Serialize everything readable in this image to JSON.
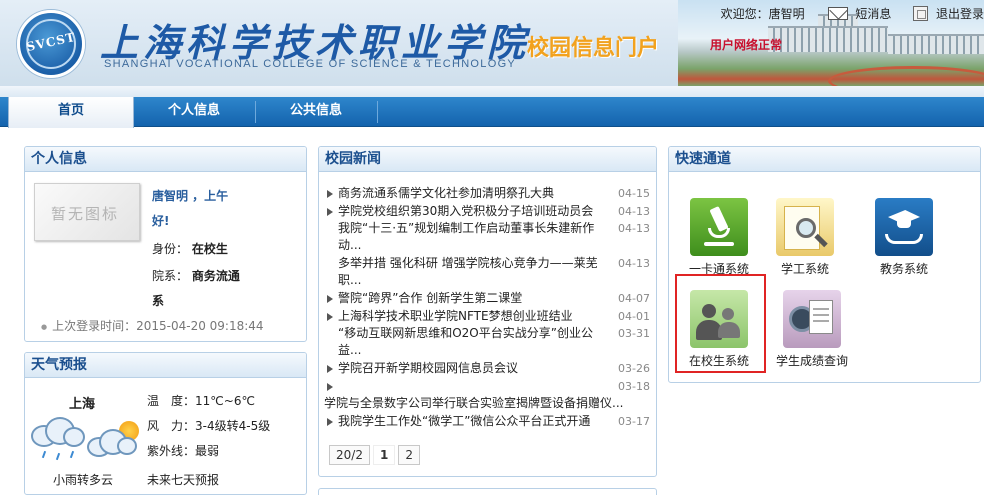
{
  "header": {
    "logo_text": "SVCST",
    "school_name_cn": "上海科学技术职业学院",
    "school_name_en": "SHANGHAI VOCATIONAL COLLEGE OF SCIENCE & TECHNOLOGY",
    "portal_title": "校园信息门户",
    "welcome": "欢迎您：唐智明",
    "messages_label": "短消息",
    "logout_label": "退出登录",
    "network_status": "用户网络正常"
  },
  "nav": {
    "tabs": [
      {
        "label": "首页",
        "active": true
      },
      {
        "label": "个人信息",
        "active": false
      },
      {
        "label": "公共信息",
        "active": false
      }
    ]
  },
  "personal": {
    "title": "个人信息",
    "avatar_placeholder": "暂无图标",
    "greeting_line1": "唐智明 ，上午",
    "greeting_line2": "好!",
    "identity_label": "身份：",
    "identity_value": "在校生",
    "dept_label": "院系：",
    "dept_value_line1": "商务流通",
    "dept_value_line2": "系",
    "last_login": "上次登录时间：2015-04-20 09:18:44"
  },
  "weather": {
    "title": "天气预报",
    "city": "上海",
    "temperature_label": "温　度：",
    "temperature_value": "11℃~6℃",
    "wind_label": "风　力：",
    "wind_value": "3-4级转4-5级",
    "uv_label": "紫外线：",
    "uv_value": "最弱",
    "description": "小雨转多云",
    "forecast_link": "未来七天预报"
  },
  "news": {
    "title": "校园新闻",
    "items": [
      {
        "title": "商务流通系儒学文化社参加清明祭孔大典",
        "date": "04-15",
        "style": "single"
      },
      {
        "title": "学院党校组织第30期入党积极分子培训班动员会",
        "date": "04-13",
        "style": "single"
      },
      {
        "title": "我院“十三·五”规划编制工作启动董事长朱建新作动...",
        "date": "04-13",
        "style": "wrap"
      },
      {
        "title": "多举并措 强化科研 增强学院核心竞争力——莱芜职...",
        "date": "04-13",
        "style": "wrap"
      },
      {
        "title": "警院“跨界”合作 创新学生第二课堂",
        "date": "04-07",
        "style": "single"
      },
      {
        "title": "上海科学技术职业学院NFTE梦想创业班结业",
        "date": "04-01",
        "style": "single"
      },
      {
        "title": "“移动互联网新思维和O2O平台实战分享”创业公益...",
        "date": "03-31",
        "style": "wrap"
      },
      {
        "title": "学院召开新学期校园网信息员会议",
        "date": "03-26",
        "style": "single"
      },
      {
        "title": "学院与全景数字公司举行联合实验室揭牌暨设备捐赠仪...",
        "date": "03-18",
        "style": "bare"
      },
      {
        "title": "我院学生工作处“微学工”微信公众平台正式开通",
        "date": "03-17",
        "style": "single"
      }
    ],
    "pager": {
      "summary": "20/2",
      "pages": [
        "1",
        "2"
      ],
      "current": "1"
    }
  },
  "quick": {
    "title": "快速通道",
    "items": [
      {
        "label": "一卡通系统",
        "icon": "microscope-icon"
      },
      {
        "label": "学工系统",
        "icon": "folder-search-icon"
      },
      {
        "label": "教务系统",
        "icon": "graduation-cap-icon"
      },
      {
        "label": "在校生系统",
        "icon": "users-icon"
      },
      {
        "label": "学生成绩查询",
        "icon": "film-clipboard-icon"
      }
    ],
    "selected_index": 3
  }
}
